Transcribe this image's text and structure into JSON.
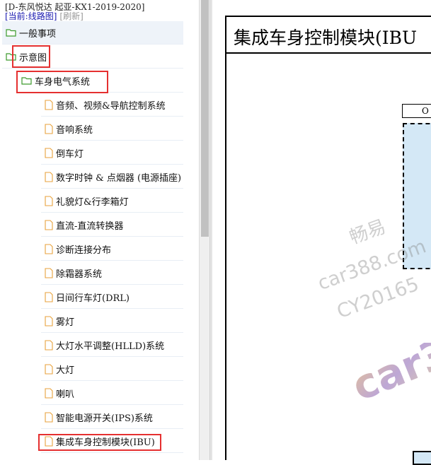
{
  "header": {
    "title": "[D-东风悦达 起亚-KX1-2019-2020]",
    "current_label": "[当前:",
    "current_value": "线路图]",
    "refresh_label": "[刷新]"
  },
  "tree": {
    "items": [
      {
        "label": "一般事项",
        "icon": "folder-open-icon"
      },
      {
        "label": "示意图",
        "icon": "folder-open-icon"
      },
      {
        "label": "车身电气系统",
        "icon": "folder-open-icon"
      },
      {
        "label": "音频、视频&导航控制系统",
        "icon": "document-icon"
      },
      {
        "label": "音响系统",
        "icon": "document-icon"
      },
      {
        "label": "倒车灯",
        "icon": "document-icon"
      },
      {
        "label": "数字时钟 & 点烟器 (电源插座)",
        "icon": "document-icon"
      },
      {
        "label": "礼貌灯&行李箱灯",
        "icon": "document-icon"
      },
      {
        "label": "直流-直流转换器",
        "icon": "document-icon"
      },
      {
        "label": "诊断连接分布",
        "icon": "document-icon"
      },
      {
        "label": "除霜器系统",
        "icon": "document-icon"
      },
      {
        "label": "日间行车灯(DRL)",
        "icon": "document-icon"
      },
      {
        "label": "雾灯",
        "icon": "document-icon"
      },
      {
        "label": "大灯水平调整(HLLD)系统",
        "icon": "document-icon"
      },
      {
        "label": "大灯",
        "icon": "document-icon"
      },
      {
        "label": "喇叭",
        "icon": "document-icon"
      },
      {
        "label": "智能电源开关(IPS)系统",
        "icon": "document-icon"
      },
      {
        "label": "集成车身控制模块(IBU)",
        "icon": "document-icon"
      }
    ]
  },
  "diagram": {
    "title": "集成车身控制模块(IBU",
    "o_label": "O"
  },
  "watermark": {
    "cn": "畅易",
    "url": "car388.com",
    "code": "CY20165",
    "logo": "car3"
  },
  "colors": {
    "highlight_row": "#eef3f9",
    "red_outline": "#e53030",
    "module_fill": "#d4e8f6",
    "folder_green": "#3c9a2c",
    "doc_orange": "#e8a23c"
  }
}
